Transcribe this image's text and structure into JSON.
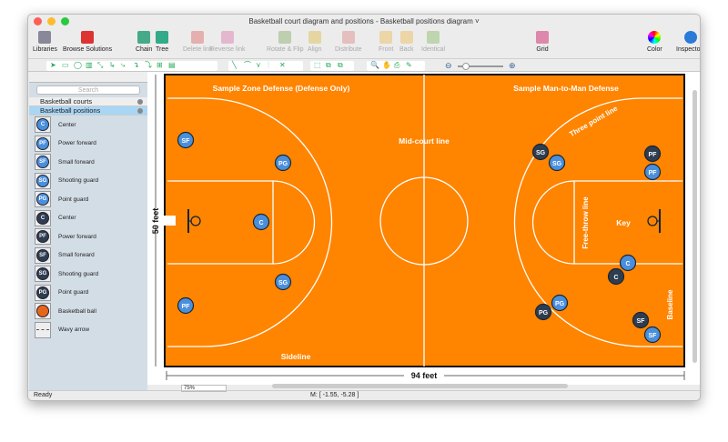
{
  "window": {
    "title": "Basketball court diagram and positions - Basketball positions diagram ˅"
  },
  "toolbar": [
    {
      "label": "Libraries",
      "enabled": true
    },
    {
      "label": "Browse Solutions",
      "enabled": true
    },
    {
      "label": "Chain",
      "enabled": true
    },
    {
      "label": "Tree",
      "enabled": true
    },
    {
      "label": "Delete link",
      "enabled": false
    },
    {
      "label": "Reverse link",
      "enabled": false
    },
    {
      "label": "Rotate & Flip",
      "enabled": false
    },
    {
      "label": "Align",
      "enabled": false
    },
    {
      "label": "Distribute",
      "enabled": false
    },
    {
      "label": "Front",
      "enabled": false
    },
    {
      "label": "Back",
      "enabled": false
    },
    {
      "label": "Identical",
      "enabled": false
    },
    {
      "label": "Grid",
      "enabled": true
    },
    {
      "label": "Color",
      "enabled": true
    },
    {
      "label": "Inspectors",
      "enabled": true
    }
  ],
  "sidebar": {
    "search_placeholder": "Search",
    "libraries": [
      "Basketball courts",
      "Basketball positions"
    ],
    "items": [
      {
        "abbr": "C",
        "label": "Center",
        "team": "light"
      },
      {
        "abbr": "PF",
        "label": "Power forward",
        "team": "light"
      },
      {
        "abbr": "SF",
        "label": "Small forward",
        "team": "light"
      },
      {
        "abbr": "SG",
        "label": "Shooting guard",
        "team": "light"
      },
      {
        "abbr": "PG",
        "label": "Point guard",
        "team": "light"
      },
      {
        "abbr": "C",
        "label": "Center",
        "team": "dark"
      },
      {
        "abbr": "PF",
        "label": "Power forward",
        "team": "dark"
      },
      {
        "abbr": "SF",
        "label": "Small forward",
        "team": "dark"
      },
      {
        "abbr": "SG",
        "label": "Shooting guard",
        "team": "dark"
      },
      {
        "abbr": "PG",
        "label": "Point guard",
        "team": "dark"
      },
      {
        "abbr": "",
        "label": "Basketball ball",
        "team": "ball"
      },
      {
        "abbr": "",
        "label": "Wavy arrow",
        "team": "arrow"
      }
    ]
  },
  "diagram": {
    "left_title": "Sample Zone Defense (Defense Only)",
    "right_title": "Sample Man-to-Man Defense",
    "midcourt": "Mid-court line",
    "three_point": "Three point line",
    "free_throw": "Free-throw line",
    "key": "Key",
    "baseline": "Baseline",
    "sideline": "Sideline",
    "width_label": "94 feet",
    "height_label": "50 feet",
    "left_players": [
      "SF",
      "PG",
      "C",
      "SG",
      "PF"
    ],
    "right_players": [
      "SG",
      "SG",
      "PF",
      "PF",
      "C",
      "C",
      "PG",
      "PG",
      "SF",
      "SF"
    ]
  },
  "colors": {
    "court": "#ff8400",
    "light": "#4a8fdc",
    "dark": "#2f3d50"
  },
  "bottom": {
    "zoom": "75%"
  },
  "status": {
    "left": "Ready",
    "mouse": "M: [ -1.55, -5.28 ]"
  }
}
